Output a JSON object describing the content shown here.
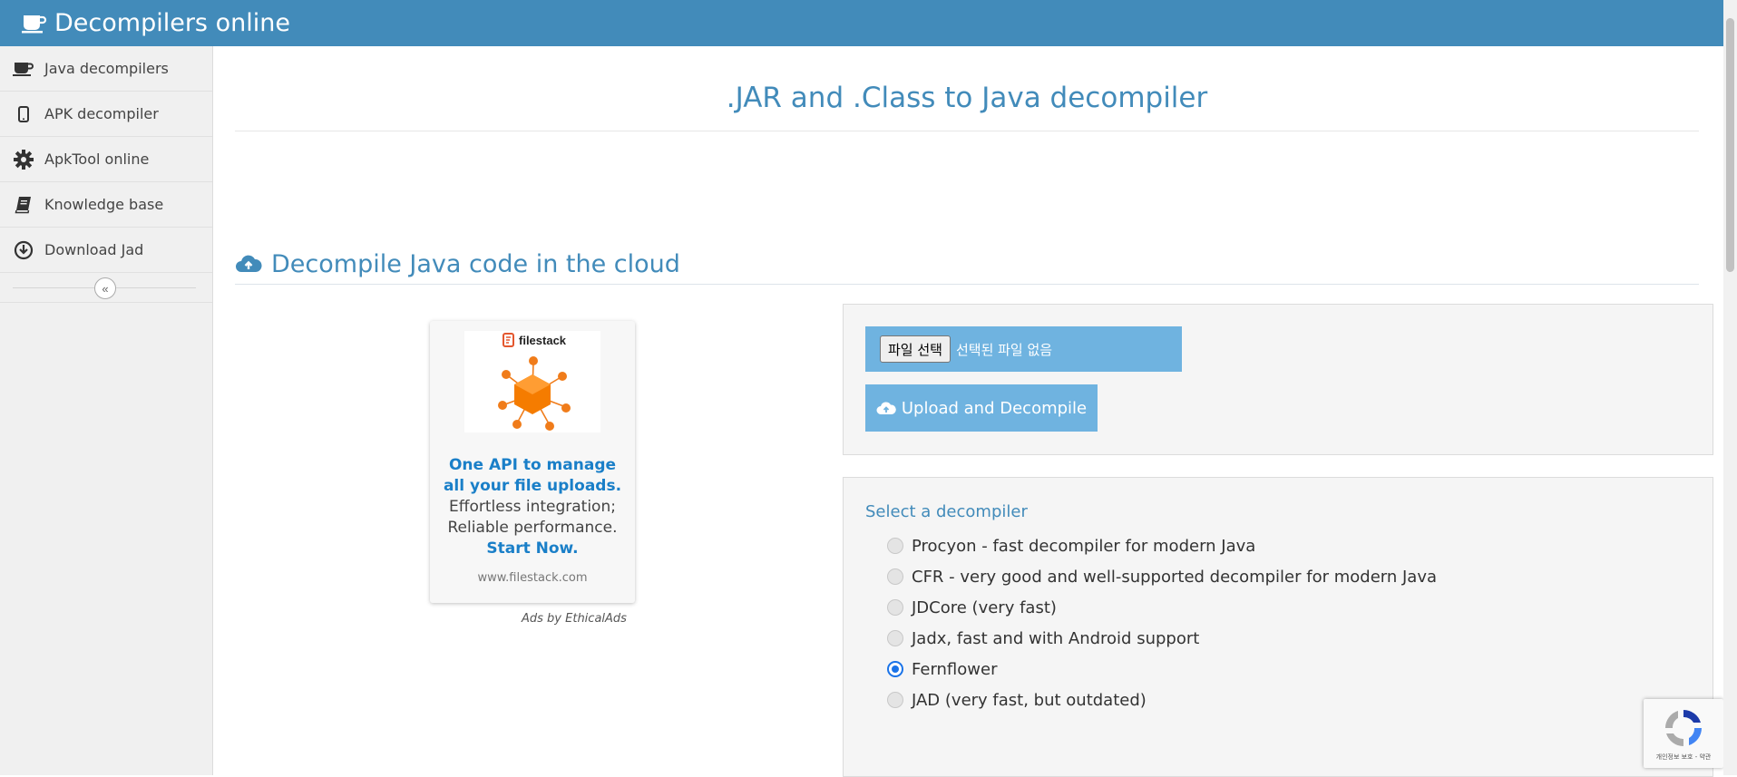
{
  "header": {
    "brand": "Decompilers online"
  },
  "sidebar": {
    "items": [
      {
        "label": "Java decompilers",
        "icon": "coffee-cup-icon"
      },
      {
        "label": "APK decompiler",
        "icon": "mobile-phone-icon"
      },
      {
        "label": "ApkTool online",
        "icon": "gear-icon"
      },
      {
        "label": "Knowledge base",
        "icon": "book-icon"
      },
      {
        "label": "Download Jad",
        "icon": "download-circle-icon"
      }
    ],
    "collapse_icon": "double-chevron-left-icon"
  },
  "main": {
    "page_title": ".JAR and .Class to Java decompiler",
    "section_title": "Decompile Java code in the cloud",
    "section_icon": "cloud-upload-icon"
  },
  "ad": {
    "brand": "filestack",
    "headline": "One API to manage all your file uploads.",
    "body": "Effortless integration; Reliable performance.",
    "cta": "Start Now.",
    "url": "www.filestack.com",
    "attribution": "Ads by EthicalAds"
  },
  "upload": {
    "file_button": "파일 선택",
    "file_status": "선택된 파일 없음",
    "submit_label": "Upload and Decompile"
  },
  "decompiler": {
    "label": "Select a decompiler",
    "options": [
      {
        "label": "Procyon - fast decompiler for modern Java",
        "checked": false
      },
      {
        "label": "CFR - very good and well-supported decompiler for modern Java",
        "checked": false
      },
      {
        "label": "JDCore (very fast)",
        "checked": false
      },
      {
        "label": "Jadx, fast and with Android support",
        "checked": false
      },
      {
        "label": "Fernflower",
        "checked": true
      },
      {
        "label": "JAD (very fast, but outdated)",
        "checked": false
      }
    ]
  },
  "recaptcha": {
    "text": "개인정보 보호 - 약관"
  },
  "colors": {
    "brand": "#428bba",
    "button": "#6fb3e0",
    "ad_link": "#1a7fc8",
    "radio_checked": "#1a73e8"
  }
}
